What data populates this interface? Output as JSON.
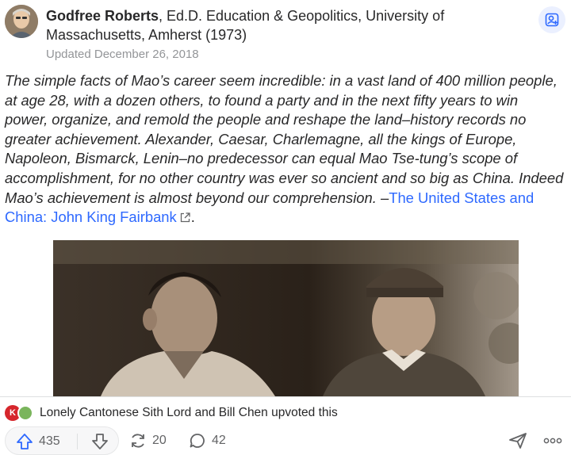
{
  "author": {
    "name": "Godfree Roberts",
    "credential": ", Ed.D. Education & Geopolitics, University of Massachusetts, Amherst (1973)",
    "updated": "Updated December 26, 2018"
  },
  "answer": {
    "quote_text": "The simple facts of Mao’s career seem incredible: in a vast land of 400 million people, at age 28, with a dozen others, to found a party and in the next fifty years to win power, organize, and remold the people and reshape the land–history records no greater achievement. Alexander, Caesar, Charlemagne, all the kings of Europe, Napoleon, Bismarck, Lenin–no predecessor can equal Mao Tse-tung’s scope of accomplishment, for no other country was ever so ancient and so big as China. Indeed Mao’s achievement is almost beyond our comprehension. –",
    "link_text": "The United States and China: John King Fairbank",
    "trailing": "."
  },
  "upvoters": {
    "text": "Lonely Cantonese Sith Lord and Bill Chen upvoted this",
    "mini_avatar_1_initials": "K"
  },
  "actions": {
    "upvotes": "435",
    "shares": "20",
    "comments": "42"
  },
  "colors": {
    "accent": "#2e69ff",
    "muted": "#939598",
    "text": "#282829"
  },
  "icons": [
    "follow-person-icon",
    "external-link-icon",
    "upvote-arrow-icon",
    "downvote-arrow-icon",
    "share-icon",
    "comment-icon",
    "send-icon",
    "more-dots-icon"
  ]
}
